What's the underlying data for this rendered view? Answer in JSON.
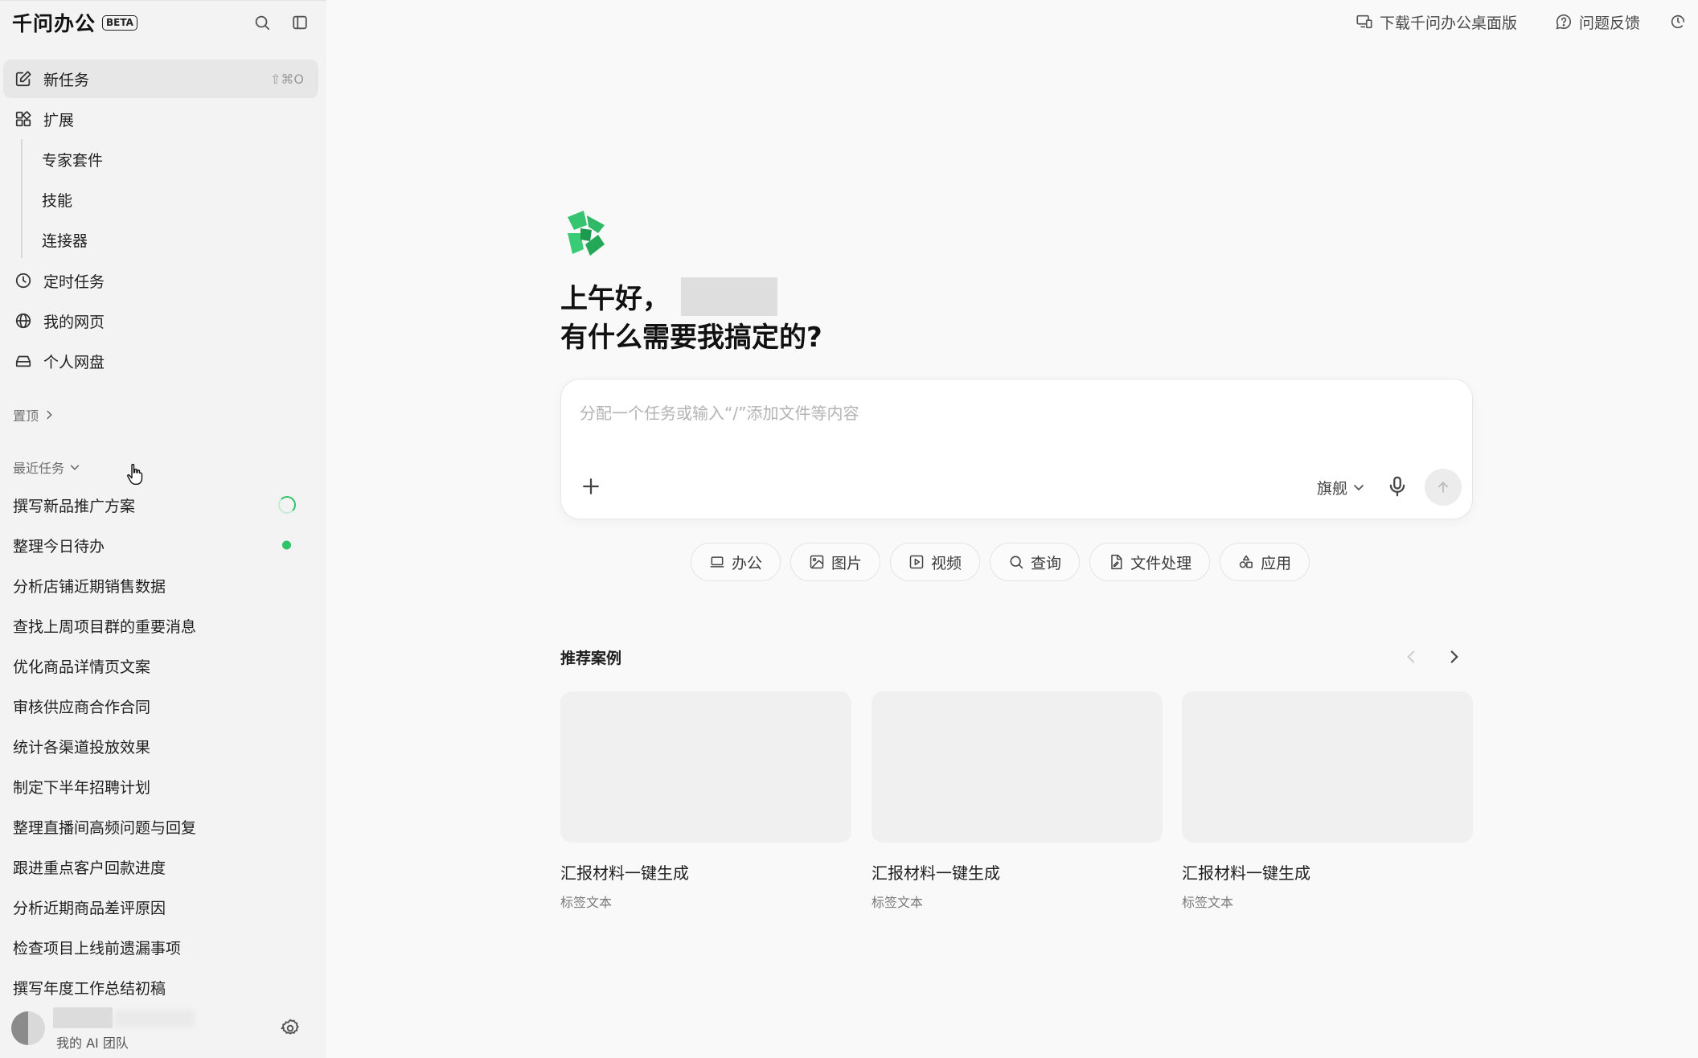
{
  "sidebar": {
    "brand": "千问办公",
    "beta": "BETA",
    "nav": [
      {
        "label": "新任务",
        "shortcut": "⇧⌘O",
        "icon": "edit-icon"
      },
      {
        "label": "扩展",
        "icon": "extensions-icon"
      }
    ],
    "extensions_sub": [
      "专家套件",
      "技能",
      "连接器"
    ],
    "nav2": [
      {
        "label": "定时任务",
        "icon": "clock-icon"
      },
      {
        "label": "我的网页",
        "icon": "globe-icon"
      },
      {
        "label": "个人网盘",
        "icon": "drive-icon"
      }
    ],
    "pinned_label": "置顶",
    "recent_label": "最近任务",
    "recent_tasks": [
      "撰写新品推广方案",
      "整理今日待办",
      "分析店铺近期销售数据",
      "查找上周项目群的重要消息",
      "优化商品详情页文案",
      "审核供应商合作合同",
      "统计各渠道投放效果",
      "制定下半年招聘计划",
      "整理直播间高频问题与回复",
      "跟进重点客户回款进度",
      "分析近期商品差评原因",
      "检查项目上线前遗漏事项",
      "撰写年度工作总结初稿"
    ],
    "user_team": "我的 AI 团队"
  },
  "header": {
    "download": "下载千问办公桌面版",
    "feedback": "问题反馈"
  },
  "main": {
    "greeting": "上午好，",
    "question": "有什么需要我搞定的?",
    "input_placeholder": "分配一个任务或输入“/”添加文件等内容",
    "model": "旗舰",
    "chips": [
      {
        "label": "办公",
        "icon": "laptop-icon"
      },
      {
        "label": "图片",
        "icon": "image-icon"
      },
      {
        "label": "视频",
        "icon": "video-icon"
      },
      {
        "label": "查询",
        "icon": "search-icon"
      },
      {
        "label": "文件处理",
        "icon": "file-icon"
      },
      {
        "label": "应用",
        "icon": "apps-icon"
      }
    ],
    "recommended_title": "推荐案例",
    "cards": [
      {
        "title": "汇报材料一键生成",
        "tag": "标签文本"
      },
      {
        "title": "汇报材料一键生成",
        "tag": "标签文本"
      },
      {
        "title": "汇报材料一键生成",
        "tag": "标签文本"
      }
    ]
  },
  "colors": {
    "accent_green": "#2fc467",
    "sidebar_bg": "#f3f3f3",
    "main_bg": "#f9f9f9"
  }
}
